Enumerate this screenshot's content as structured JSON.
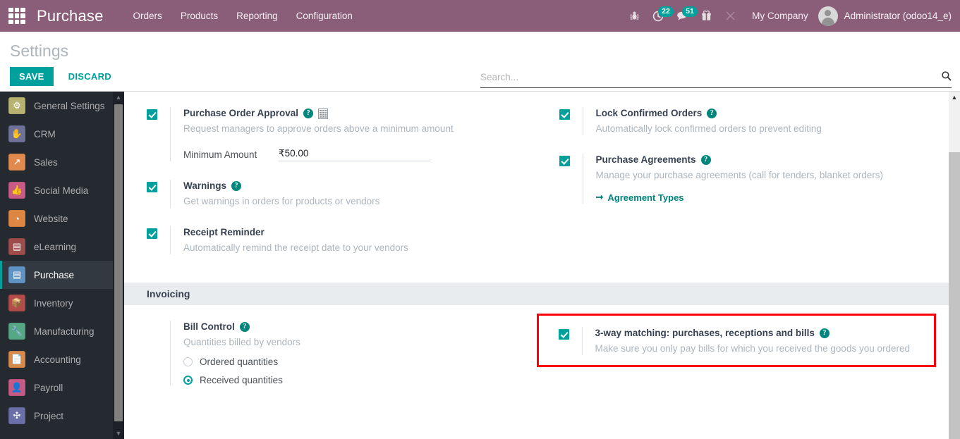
{
  "topbar": {
    "apps_icon": "apps-grid-icon",
    "brand": "Purchase",
    "menu": [
      {
        "label": "Orders"
      },
      {
        "label": "Products"
      },
      {
        "label": "Reporting"
      },
      {
        "label": "Configuration"
      }
    ],
    "sysicons": [
      {
        "name": "bug-icon",
        "glyph": "☣",
        "badge": null
      },
      {
        "name": "activity-clock-icon",
        "glyph": "◴",
        "badge": "22"
      },
      {
        "name": "messages-icon",
        "glyph": "💬",
        "badge": "51"
      },
      {
        "name": "gift-icon",
        "glyph": "🎁",
        "badge": null
      },
      {
        "name": "tools-icon",
        "glyph": "⚔",
        "badge": null
      }
    ],
    "company": "My Company",
    "user": "Administrator (odoo14_e)",
    "accent": "#8a5d79"
  },
  "controlpanel": {
    "title": "Settings",
    "save_label": "SAVE",
    "discard_label": "DISCARD",
    "search_placeholder": "Search...",
    "search_value": "",
    "search_icon": "search-icon"
  },
  "sidebar": {
    "items": [
      {
        "label": "General Settings",
        "icon": "gear-icon",
        "glyph": "⚙",
        "color": "#b8b270",
        "active": false
      },
      {
        "label": "CRM",
        "icon": "handshake-icon",
        "glyph": "✋",
        "color": "#6e7299",
        "active": false
      },
      {
        "label": "Sales",
        "icon": "chart-line-icon",
        "glyph": "↗",
        "color": "#e08a4e",
        "active": false
      },
      {
        "label": "Social Media",
        "icon": "thumbs-up-icon",
        "glyph": "👍",
        "color": "#c75b86",
        "active": false
      },
      {
        "label": "Website",
        "icon": "globe-icon",
        "glyph": "◔",
        "color": "#dd8644",
        "active": false
      },
      {
        "label": "eLearning",
        "icon": "presentation-icon",
        "glyph": "▤",
        "color": "#9e4c4c",
        "active": false
      },
      {
        "label": "Purchase",
        "icon": "credit-card-icon",
        "glyph": "▤",
        "color": "#5f93c4",
        "active": true
      },
      {
        "label": "Inventory",
        "icon": "box-icon",
        "glyph": "📦",
        "color": "#b44b4b",
        "active": false
      },
      {
        "label": "Manufacturing",
        "icon": "wrench-icon",
        "glyph": "🔧",
        "color": "#55a883",
        "active": false
      },
      {
        "label": "Accounting",
        "icon": "invoice-icon",
        "glyph": "📄",
        "color": "#d78a4a",
        "active": false
      },
      {
        "label": "Payroll",
        "icon": "employee-badge-icon",
        "glyph": "👤",
        "color": "#c55b84",
        "active": false
      },
      {
        "label": "Project",
        "icon": "puzzle-icon",
        "glyph": "✣",
        "color": "#6a6fa8",
        "active": false
      }
    ],
    "scroll_up_icon": "chevron-up-icon",
    "scroll_down_icon": "chevron-down-icon"
  },
  "settings": {
    "purchase_order_approval": {
      "title": "Purchase Order Approval",
      "desc": "Request managers to approve orders above a minimum amount",
      "checked": true,
      "help_icon": "help-icon",
      "company_icon": "building-icon",
      "field_label": "Minimum Amount",
      "field_value": "₹50.00"
    },
    "lock_confirmed_orders": {
      "title": "Lock Confirmed Orders",
      "desc": "Automatically lock confirmed orders to prevent editing",
      "checked": true,
      "help_icon": "help-icon"
    },
    "warnings": {
      "title": "Warnings",
      "desc": "Get warnings in orders for products or vendors",
      "checked": true,
      "help_icon": "help-icon"
    },
    "purchase_agreements": {
      "title": "Purchase Agreements",
      "desc": "Manage your purchase agreements (call for tenders, blanket orders)",
      "checked": true,
      "help_icon": "help-icon",
      "link_label": "Agreement Types",
      "link_icon": "arrow-right-icon"
    },
    "receipt_reminder": {
      "title": "Receipt Reminder",
      "desc": "Automatically remind the receipt date to your vendors",
      "checked": true
    },
    "invoicing_header": "Invoicing",
    "bill_control": {
      "title": "Bill Control",
      "desc": "Quantities billed by vendors",
      "help_icon": "help-icon",
      "options": [
        {
          "label": "Ordered quantities",
          "selected": false
        },
        {
          "label": "Received quantities",
          "selected": true
        }
      ]
    },
    "three_way_matching": {
      "title": "3-way matching: purchases, receptions and bills",
      "desc": "Make sure you only pay bills for which you received the goods you ordered",
      "checked": true,
      "help_icon": "help-icon",
      "highlight_color": "#fb0007"
    }
  },
  "colors": {
    "accent_teal": "#00a09d",
    "topbar_purple": "#8a5d79",
    "sidebar_dark": "#252a31",
    "highlight_red": "#fb0007"
  }
}
